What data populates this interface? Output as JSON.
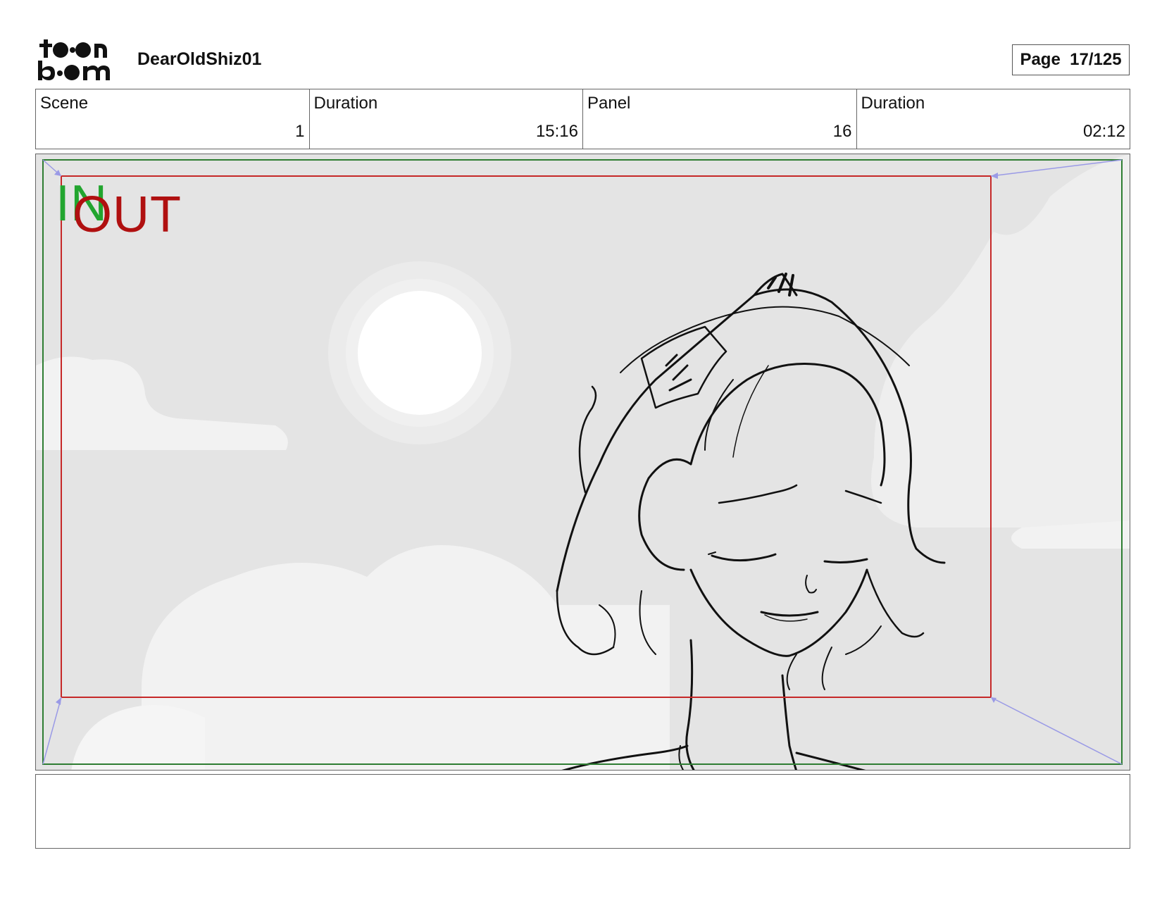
{
  "header": {
    "logo_alt": "toon boom",
    "project_title": "DearOldShiz01",
    "page_label": "Page  17/125"
  },
  "info": {
    "scene_label": "Scene",
    "scene_value": "1",
    "scene_duration_label": "Duration",
    "scene_duration_value": "15:16",
    "panel_label": "Panel",
    "panel_value": "16",
    "panel_duration_label": "Duration",
    "panel_duration_value": "02:12"
  },
  "panel": {
    "in_label": "IN",
    "out_label": "OUT",
    "colors": {
      "in_frame": "#2e7d32",
      "out_frame": "#c62828",
      "camera_arrows": "#9a9ae6",
      "sky": "#e6e6e6",
      "clouds": "#f2f2f2",
      "sun": "#ffffff"
    }
  },
  "notes": {
    "text": ""
  }
}
